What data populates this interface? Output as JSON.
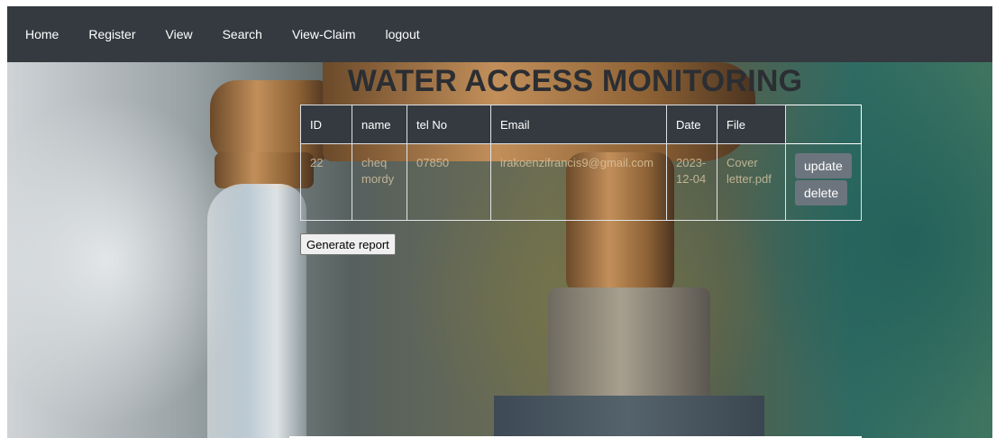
{
  "nav": {
    "items": [
      "Home",
      "Register",
      "View",
      "Search",
      "View-Claim",
      "logout"
    ]
  },
  "page": {
    "title": "WATER ACCESS MONITORING"
  },
  "table": {
    "headers": [
      "ID",
      "name",
      "tel No",
      "Email",
      "Date",
      "File",
      ""
    ],
    "rows": [
      {
        "id": "22",
        "name": "cheq mordy",
        "tel": "07850",
        "email": "irakoenzifrancis9@gmail.com",
        "date": "2023-12-04",
        "file": "Cover letter.pdf"
      }
    ],
    "update_label": "update",
    "delete_label": "delete"
  },
  "report_button_label": "Generate report",
  "colors": {
    "navbar_bg": "#343a40",
    "table_header_bg": "#343a40",
    "action_button_bg": "#6c757d"
  }
}
